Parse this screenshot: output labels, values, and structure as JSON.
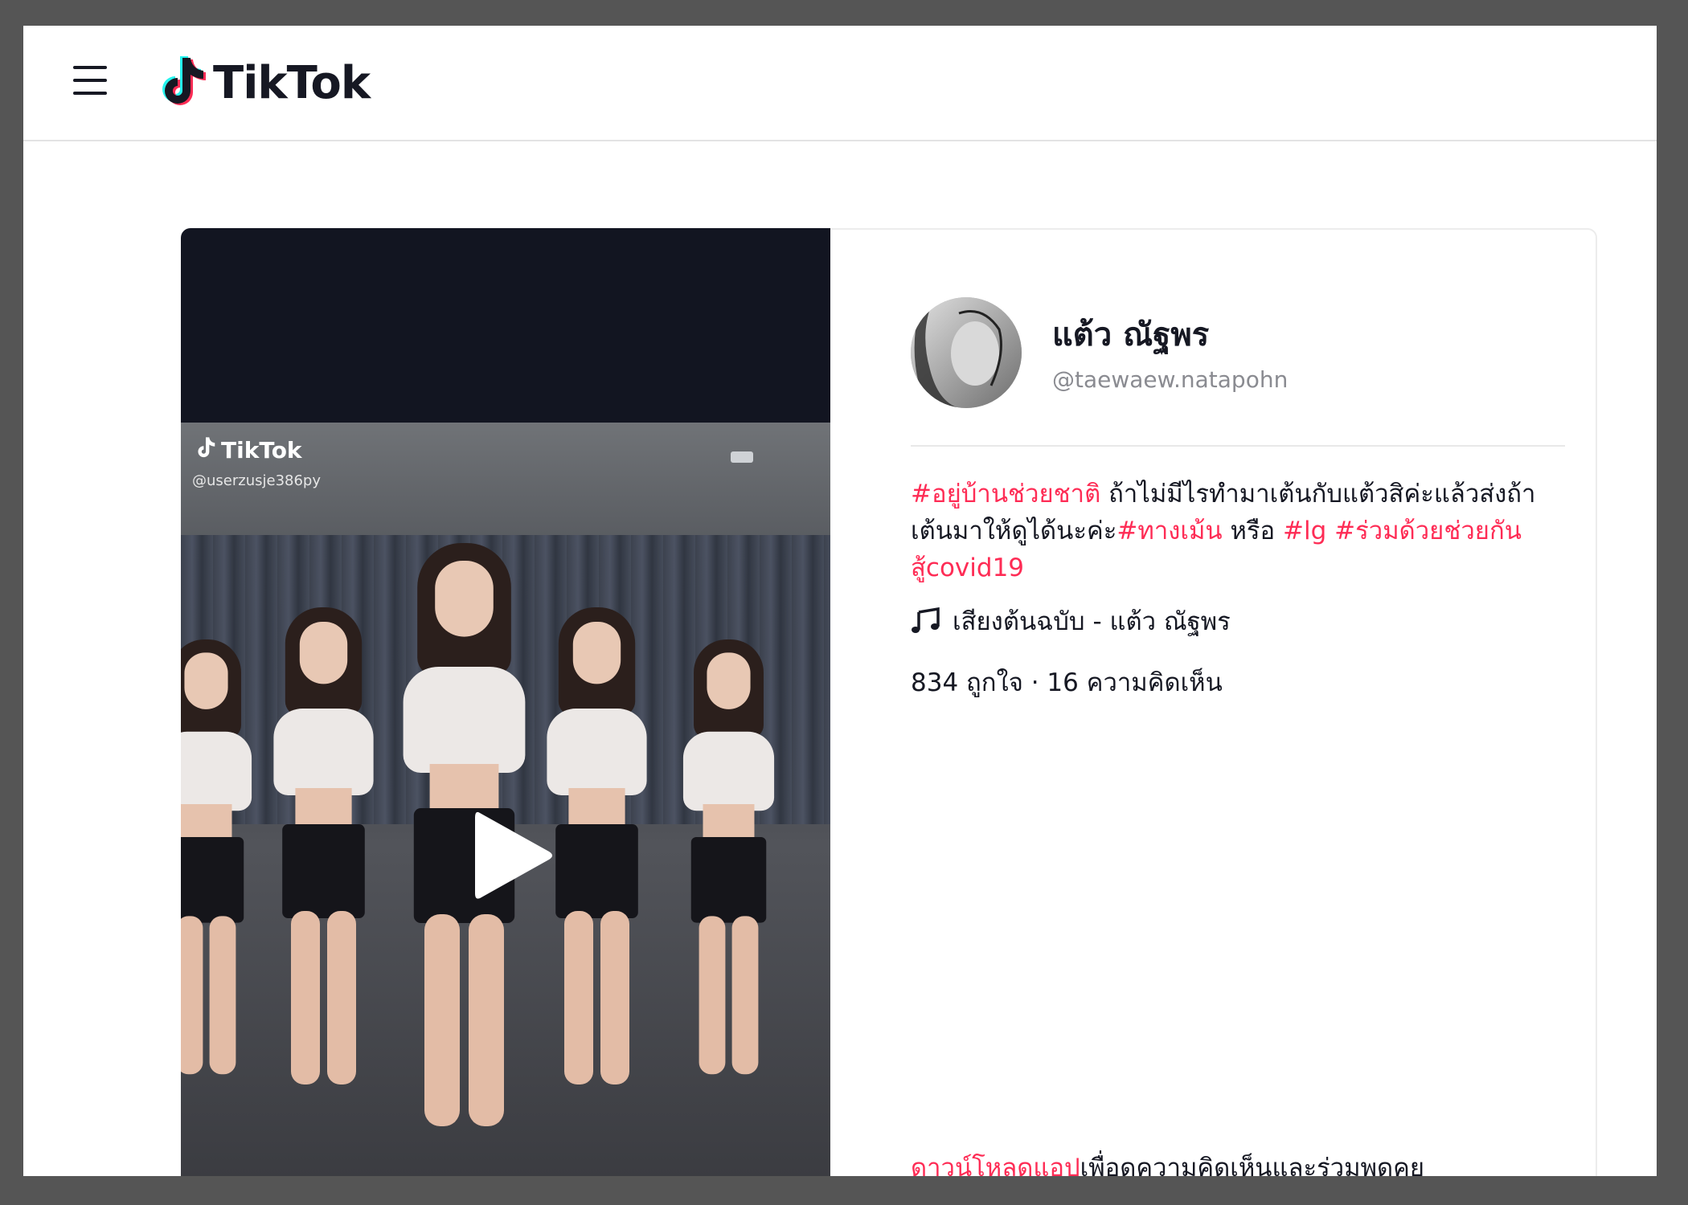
{
  "header": {
    "menu_icon": "hamburger-menu-icon",
    "logo_icon": "tiktok-note-icon",
    "logo_text": "TikTok"
  },
  "video": {
    "watermark_logo": "TikTok",
    "watermark_user": "@userzusje386py",
    "play_icon": "play-icon"
  },
  "author": {
    "display_name": "แต้ว ณัฐพร",
    "username": "@taewaew.natapohn"
  },
  "caption": {
    "tag1": "#อยู่บ้านช่วยชาติ",
    "text1": " ถ้าไม่มีไรทำมาเต้นกับแต้วสิค่ะแล้วส่งถ้าเต้นมาให้ดูได้นะค่ะ",
    "tag2": "#ทางเม้น",
    "text2": " หรือ ",
    "tag3": "#lg",
    "text3": " ",
    "tag4": "#ร่วมด้วยช่วยกันสู้covid19"
  },
  "music": {
    "icon": "music-note-icon",
    "label": "เสียงต้นฉบับ - แต้ว ณัฐพร"
  },
  "stats": {
    "text": "834 ถูกใจ · 16 ความคิดเห็น"
  },
  "cta": {
    "link": "ดาวน์โหลดแอป",
    "text": "เพื่อดูความคิดเห็นและร่วมพูดคุย"
  },
  "colors": {
    "accent": "#fe2c55",
    "text": "#161823",
    "muted": "#8a8b91",
    "video_bg": "#121521"
  }
}
